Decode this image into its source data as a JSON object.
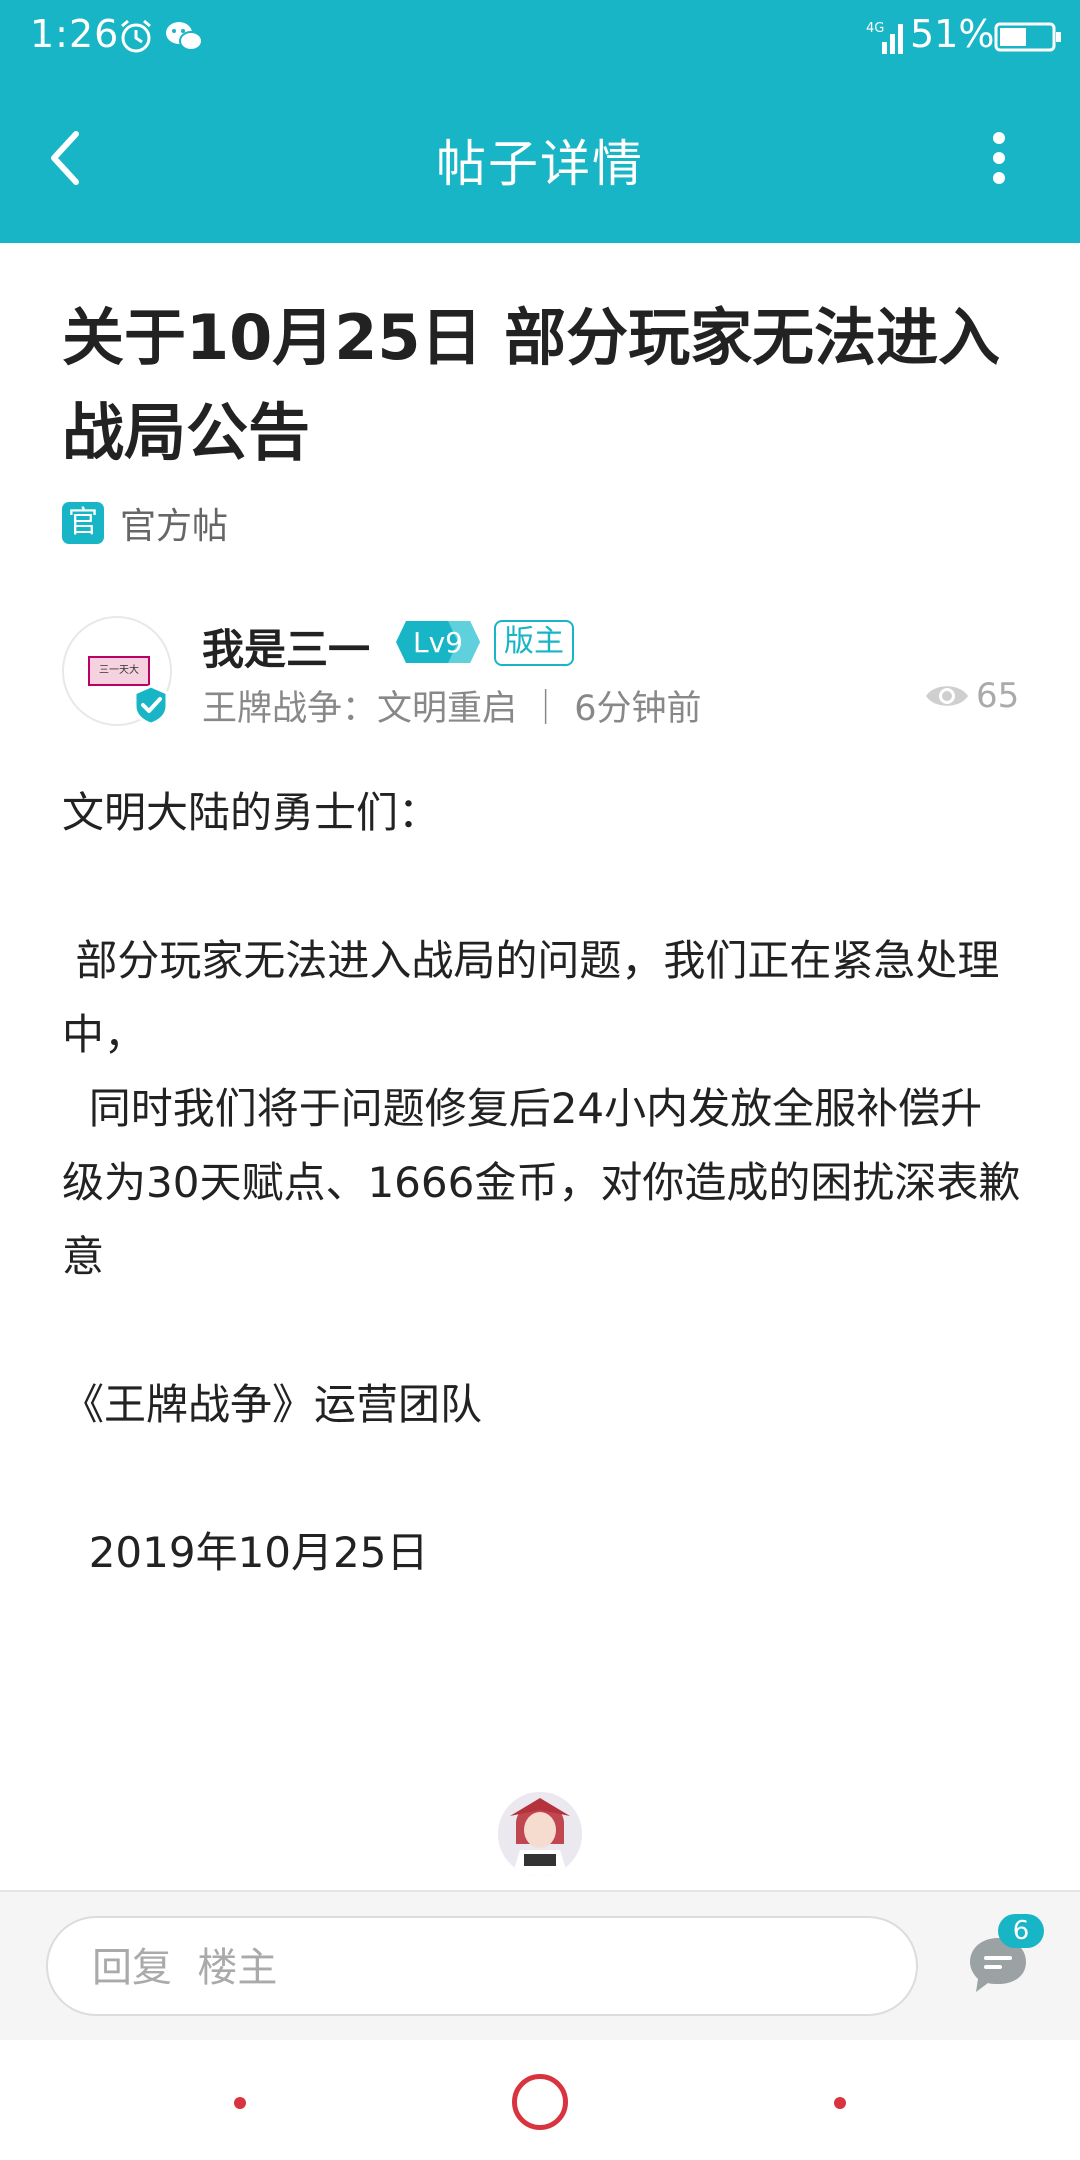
{
  "status_bar": {
    "time": "1:26",
    "network": "4G",
    "battery_percent": "51%",
    "battery_level": 0.51,
    "icons": [
      "alarm-icon",
      "wechat-icon",
      "signal-icon",
      "battery-icon"
    ]
  },
  "app_bar": {
    "title": "帖子详情",
    "back_icon": "back-arrow-icon",
    "more_icon": "more-vertical-icon",
    "background_color": "#17b5c6"
  },
  "post": {
    "title": "关于10月25日 部分玩家无法进入战局公告",
    "official_tag_icon": "官",
    "official_tag_label": "官方帖",
    "author": {
      "name": "我是三一",
      "level": "Lv9",
      "role": "版主",
      "avatar_text": "三一天大",
      "meta": "王牌战争：文明重启 ｜ 6分钟前"
    },
    "views": "65",
    "content": "文明大陆的勇士们：\n\n 部分玩家无法进入战局的问题，我们正在紧急处理中，\n  同时我们将于问题修复后24小内发放全服补偿升级为30天赋点、1666金币，对你造成的困扰深表歉意\n\n《王牌战争》运营团队\n\n  2019年10月25日"
  },
  "reply_bar": {
    "placeholder": "回复  楼主",
    "comment_count": "6"
  },
  "colors": {
    "accent": "#17b5c6",
    "nav_red": "#d9333f"
  }
}
